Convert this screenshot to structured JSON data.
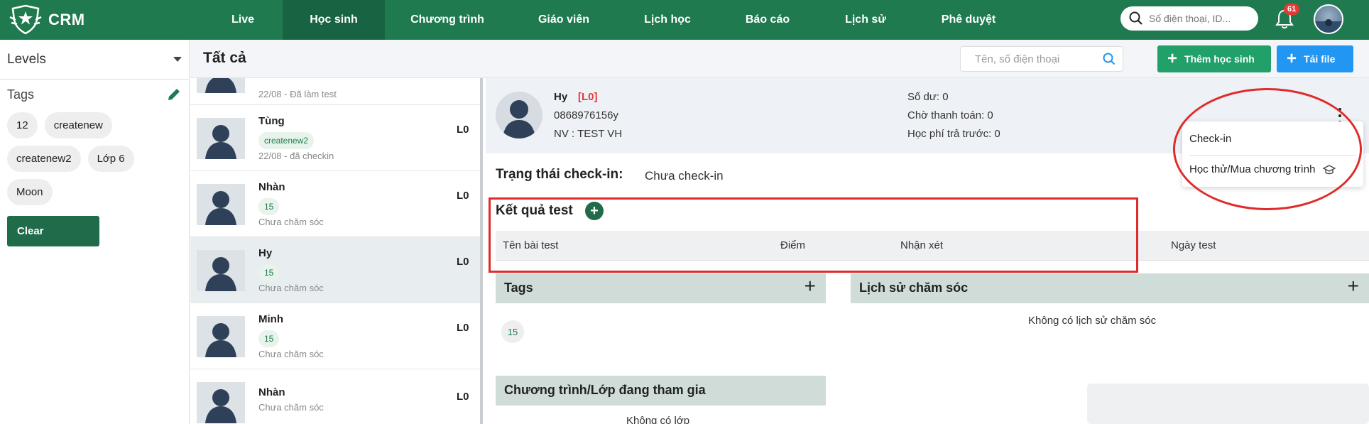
{
  "topbar": {
    "logo_text": "CRM",
    "nav": [
      "Live",
      "Học sinh",
      "Chương trình",
      "Giáo viên",
      "Lịch học",
      "Báo cáo",
      "Lịch sử",
      "Phê duyệt"
    ],
    "active_nav": "Học sinh",
    "search_placeholder": "Số điện thoại, ID...",
    "notification_count": "61",
    "icons": [
      "logo-icon",
      "search-icon",
      "bell-icon",
      "avatar"
    ]
  },
  "filters": {
    "levels_label": "Levels",
    "tags_label": "Tags",
    "tags": [
      "12",
      "createnew",
      "createnew2",
      "Lớp 6",
      "Moon"
    ],
    "clear_label": "Clear"
  },
  "header": {
    "title": "Tất cả",
    "search_placeholder": "Tên, số điện thoại",
    "add_student_label": "Thêm học sinh",
    "upload_label": "Tải file"
  },
  "students": [
    {
      "name": "",
      "tag": "",
      "note": "22/08 - Đã làm test",
      "level": ""
    },
    {
      "name": "Tùng",
      "tag": "createnew2",
      "note": "22/08 - đã checkin",
      "level": "L0"
    },
    {
      "name": "Nhàn",
      "tag": "15",
      "note": "Chưa chăm sóc",
      "level": "L0"
    },
    {
      "name": "Hy",
      "tag": "15",
      "note": "Chưa chăm sóc",
      "level": "L0"
    },
    {
      "name": "Minh",
      "tag": "15",
      "note": "Chưa chăm sóc",
      "level": "L0"
    },
    {
      "name": "Nhàn",
      "tag": "",
      "note": "Chưa chăm sóc",
      "level": "L0"
    }
  ],
  "detail": {
    "name": "Hy",
    "level": "[L0]",
    "phone": "0868976156y",
    "staff": "NV : TEST VH",
    "balance": "Số dư: 0",
    "pending_payment": "Chờ thanh toán: 0",
    "prepaid": "Học phí trả trước: 0",
    "checkin_label": "Trạng thái check-in:",
    "checkin_value": "Chưa check-in",
    "tests_title": "Kết quả test",
    "test_columns": [
      "Tên bài test",
      "Điểm",
      "Nhận xét",
      "Ngày test"
    ],
    "tags_title": "Tags",
    "tags": [
      "15"
    ],
    "history_title": "Lịch sử chăm sóc",
    "history_empty": "Không có lịch sử chăm sóc",
    "programs_title": "Chương trình/Lớp đang tham gia",
    "programs_empty": "Không có lớp"
  },
  "menu": {
    "items": [
      "Check-in",
      "Học thử/Mua chương trình"
    ]
  },
  "colors": {
    "brand_green": "#1f7a4f",
    "active_nav": "#186341",
    "button_green": "#21a06a",
    "button_blue": "#2196f3",
    "annotation_red": "#e02b2b",
    "level_red": "#e53935"
  }
}
